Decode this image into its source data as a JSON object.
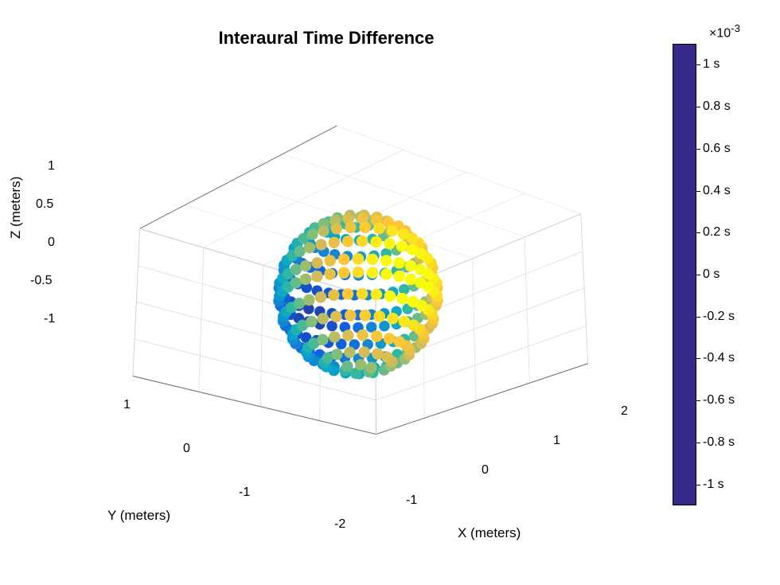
{
  "chart_data": {
    "type": "scatter",
    "title": "Interaural Time Difference",
    "xlabel": "X (meters)",
    "ylabel": "Y (meters)",
    "zlabel": "Z (meters)",
    "x_ticks": [
      -2,
      -1,
      0,
      1,
      2
    ],
    "y_ticks": [
      -1,
      0,
      1
    ],
    "z_ticks": [
      -1,
      -0.5,
      0,
      0.5,
      1
    ],
    "xlim": [
      -2,
      2
    ],
    "ylim": [
      -2,
      2
    ],
    "zlim": [
      -1,
      1
    ],
    "colorbar": {
      "label_suffix": " s",
      "exponent": "×10",
      "exponent_pow": "-3",
      "ticks": [
        -1,
        -0.8,
        -0.6,
        -0.4,
        -0.2,
        0,
        0.2,
        0.4,
        0.6,
        0.8,
        1
      ],
      "min": -1.1,
      "max": 1.1,
      "colormap": "parula"
    },
    "description": "3D scatter: points lie on a sphere of radius ≈1 centered at origin, arranged in latitude rings. Color = interaural time difference (s ×10^-3), roughly proportional to Y coordinate (≈ -1e-3 s at Y=-1, ≈ +1e-3 s at Y=+1).",
    "sphere": {
      "radius": 1.0,
      "elevations_deg": [
        -80,
        -65,
        -50,
        -35,
        -20,
        -5,
        5,
        20,
        35,
        50,
        65,
        80
      ],
      "azimuth_step_deg": 10,
      "color_value_formula": "y * 1e-3"
    }
  },
  "labels": {
    "title": "Interaural Time Difference",
    "x": "X (meters)",
    "y": "Y (meters)",
    "z": "Z (meters)"
  },
  "parula_stops": [
    {
      "p": 0.0,
      "c": "#352a87"
    },
    {
      "p": 0.1,
      "c": "#0b5cde"
    },
    {
      "p": 0.2,
      "c": "#1481d6"
    },
    {
      "p": 0.32,
      "c": "#06a4ca"
    },
    {
      "p": 0.42,
      "c": "#2eb7a4"
    },
    {
      "p": 0.55,
      "c": "#87bf77"
    },
    {
      "p": 0.65,
      "c": "#d1bb59"
    },
    {
      "p": 0.8,
      "c": "#fec832"
    },
    {
      "p": 0.92,
      "c": "#f9fb0e"
    },
    {
      "p": 1.0,
      "c": "#f9fb0e"
    }
  ]
}
